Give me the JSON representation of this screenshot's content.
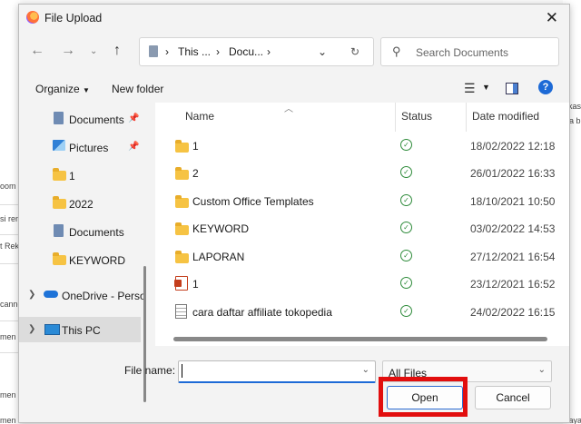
{
  "window": {
    "title": "File Upload"
  },
  "nav": {
    "breadcrumb": [
      "This ...",
      "Docu...",
      "›",
      "›"
    ],
    "search_placeholder": "Search Documents"
  },
  "toolbar": {
    "organize": "Organize",
    "new_folder": "New folder"
  },
  "sidebar": {
    "items": [
      {
        "label": "Documents",
        "icon": "documents-icon",
        "pinned": true
      },
      {
        "label": "Pictures",
        "icon": "pictures-icon",
        "pinned": true
      },
      {
        "label": "1",
        "icon": "folder-icon"
      },
      {
        "label": "2022",
        "icon": "folder-icon"
      },
      {
        "label": "Documents",
        "icon": "documents-icon"
      },
      {
        "label": "KEYWORD",
        "icon": "folder-icon"
      },
      {
        "label": "OneDrive - Perso",
        "icon": "onedrive-icon"
      },
      {
        "label": "This PC",
        "icon": "pc-icon"
      }
    ]
  },
  "filelist": {
    "headers": {
      "name": "Name",
      "status": "Status",
      "date": "Date modified"
    },
    "rows": [
      {
        "name": "1",
        "type": "folder",
        "date": "18/02/2022 12:18"
      },
      {
        "name": "2",
        "type": "folder",
        "date": "26/01/2022 16:33"
      },
      {
        "name": "Custom Office Templates",
        "type": "folder",
        "date": "18/10/2021 10:50"
      },
      {
        "name": "KEYWORD",
        "type": "folder",
        "date": "03/02/2022 14:53"
      },
      {
        "name": "LAPORAN",
        "type": "folder",
        "date": "27/12/2021 16:54"
      },
      {
        "name": "1",
        "type": "pdf",
        "date": "23/12/2021 16:52"
      },
      {
        "name": "cara daftar affiliate tokopedia",
        "type": "doc",
        "date": "24/02/2022 16:15"
      }
    ]
  },
  "bottom": {
    "file_name_label": "File name:",
    "file_name_value": "",
    "file_type": "All Files",
    "open_label": "Open",
    "cancel_label": "Cancel"
  },
  "background": {
    "left": [
      "oom",
      "si rem",
      "t Rek",
      "cannel",
      "men ta",
      "men ta",
      "men tanpa judul"
    ],
    "right": [
      "likas",
      "da b",
      "saya"
    ]
  },
  "colors": {
    "accent": "#1d6ad6",
    "highlight": "#e20e0e",
    "status_ok": "#2e8b3a"
  }
}
